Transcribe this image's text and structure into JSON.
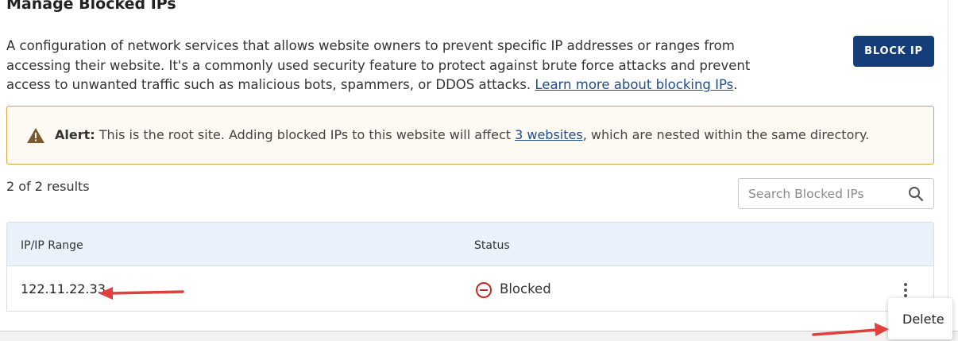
{
  "page": {
    "title": "Manage Blocked IPs",
    "description": "A configuration of network services that allows website owners to prevent specific IP addresses or ranges from accessing their website. It's a commonly used security feature to protect against brute force attacks and prevent access to unwanted traffic such as malicious bots, spammers, or DDOS attacks.",
    "learn_more_link": "Learn more about blocking IPs",
    "learn_more_suffix": ".",
    "block_ip_button": "BLOCK IP"
  },
  "alert": {
    "icon": "warning-icon",
    "label": "Alert:",
    "text_before": "This is the root site. Adding blocked IPs to this website will affect",
    "link": "3 websites",
    "text_after": ", which are nested within the same directory.",
    "border_color": "#d9a83c"
  },
  "results": {
    "count_text": "2 of 2 results"
  },
  "search": {
    "placeholder": "Search Blocked IPs",
    "value": "",
    "icon": "search-icon"
  },
  "table": {
    "columns": [
      "IP/IP Range",
      "Status"
    ],
    "rows": [
      {
        "ip": "122.11.22.33",
        "status": "Blocked",
        "status_icon": "blocked-icon",
        "status_color": "#c62828"
      }
    ]
  },
  "row_menu": {
    "items": [
      "Delete"
    ]
  },
  "colors": {
    "primary": "#143d7a",
    "link": "#1f4d8c",
    "table_header_bg": "#e9f1fa",
    "annotation_arrow": "#e0403c"
  }
}
